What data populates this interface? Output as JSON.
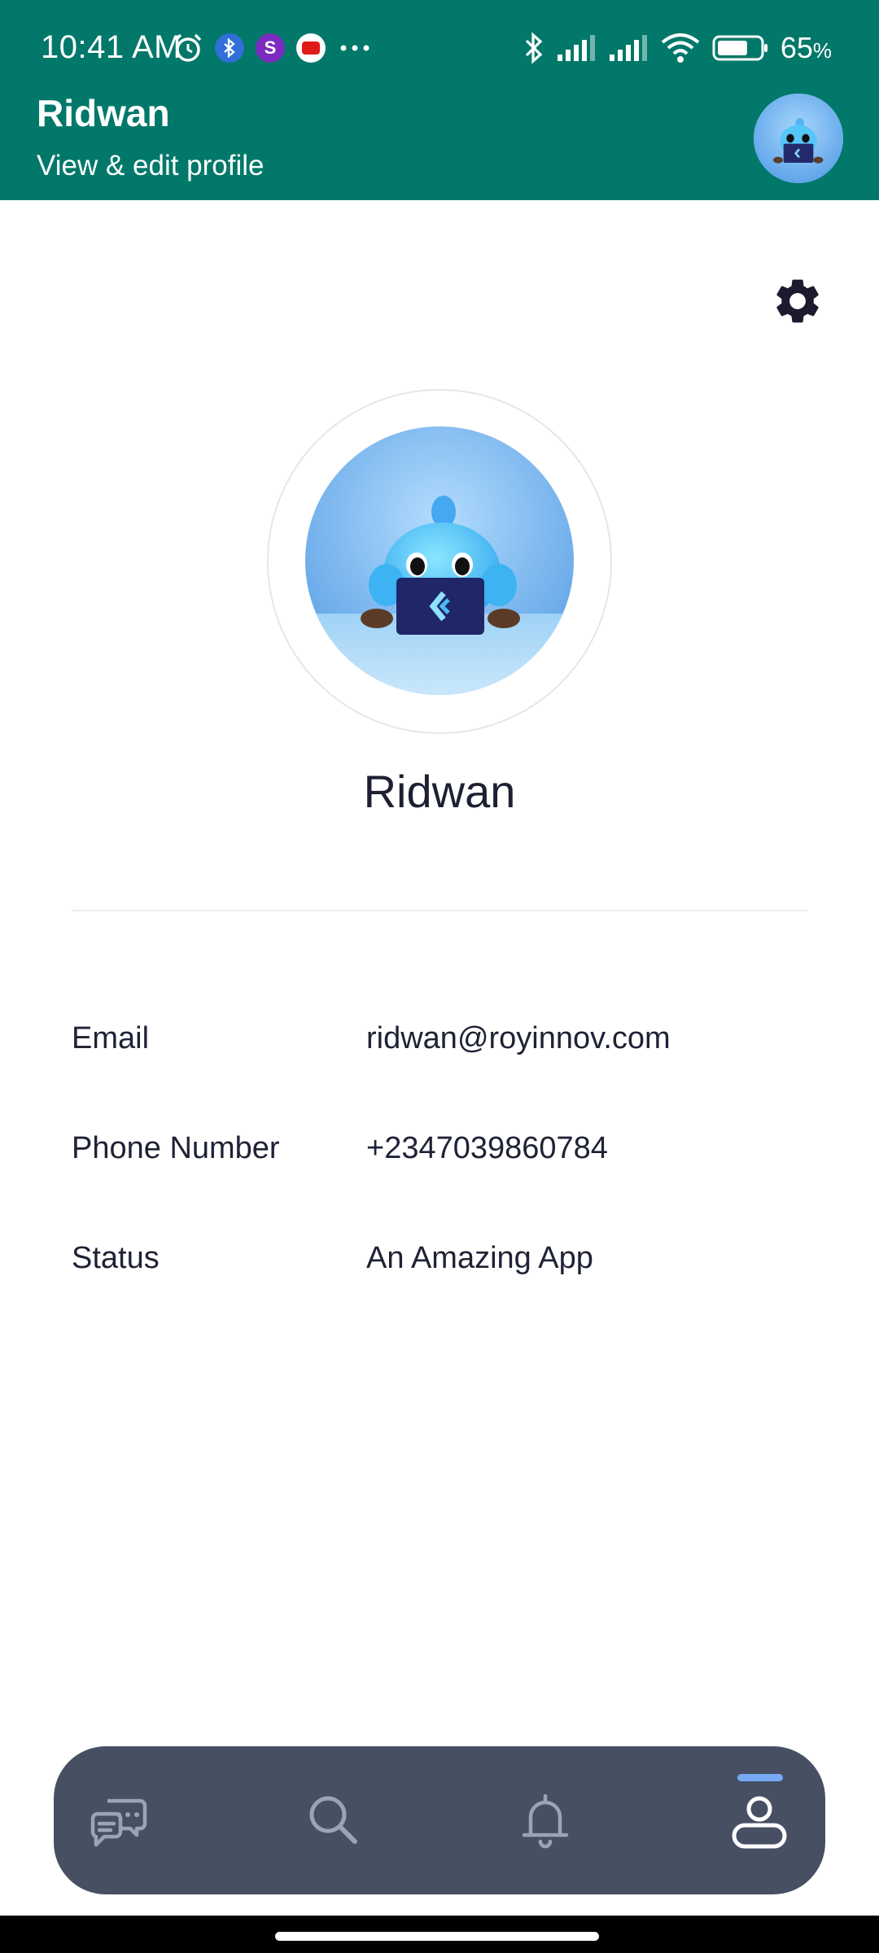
{
  "status_bar": {
    "time": "10:41 AM",
    "battery_percent": "65",
    "battery_unit": "%",
    "icons_left": [
      "alarm-icon",
      "bluetooth-app-icon",
      "music-app-icon",
      "youtube-icon",
      "more-dots-icon"
    ],
    "icons_right": [
      "bluetooth-icon",
      "signal-icon",
      "signal-icon",
      "wifi-icon",
      "battery-icon"
    ]
  },
  "header": {
    "title": "Ridwan",
    "subtitle": "View & edit profile",
    "background_color": "#017869"
  },
  "profile": {
    "name": "Ridwan",
    "fields": [
      {
        "label": "Email",
        "value": "ridwan@royinnov.com"
      },
      {
        "label": "Phone Number",
        "value": "+2347039860784"
      },
      {
        "label": "Status",
        "value": "An Amazing App"
      }
    ]
  },
  "bottom_nav": {
    "items": [
      {
        "icon": "chat-bubbles-icon",
        "active": false
      },
      {
        "icon": "search-icon",
        "active": false
      },
      {
        "icon": "bell-icon",
        "active": false
      },
      {
        "icon": "person-icon",
        "active": true
      }
    ],
    "background_color": "#474f63",
    "active_indicator_color": "#78aaf4"
  }
}
